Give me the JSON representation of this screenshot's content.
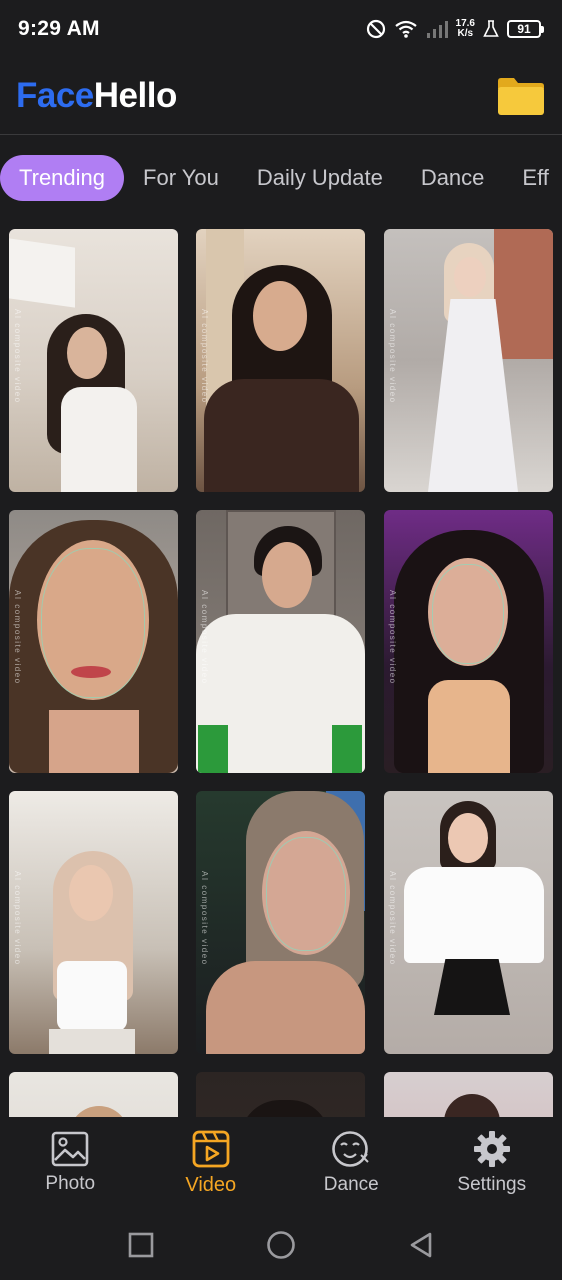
{
  "status_bar": {
    "time": "9:29 AM",
    "speed_value": "17.6",
    "speed_unit": "K/s",
    "battery": "91",
    "icons": [
      "dnd-icon",
      "wifi-icon",
      "signal-icon",
      "flask-icon"
    ]
  },
  "header": {
    "logo_part1": "Face",
    "logo_part2": "Hello",
    "folder_icon": "folder-icon",
    "colors": {
      "logo_blue": "#2d6cf0",
      "folder_yellow": "#f6c93c"
    }
  },
  "tabs": [
    {
      "label": "Trending",
      "active": true
    },
    {
      "label": "For You",
      "active": false
    },
    {
      "label": "Daily Update",
      "active": false
    },
    {
      "label": "Dance",
      "active": false
    },
    {
      "label": "Eff",
      "active": false
    }
  ],
  "tab_accent": "#b07ef3",
  "watermark_text": "AI composite video",
  "bottom_nav": [
    {
      "label": "Photo",
      "icon": "image-icon",
      "active": false
    },
    {
      "label": "Video",
      "icon": "video-icon",
      "active": true
    },
    {
      "label": "Dance",
      "icon": "dance-face-icon",
      "active": false
    },
    {
      "label": "Settings",
      "icon": "gear-icon",
      "active": false
    }
  ],
  "active_nav_color": "#f5a623",
  "system_nav": [
    "recents-icon",
    "home-icon",
    "back-icon"
  ]
}
